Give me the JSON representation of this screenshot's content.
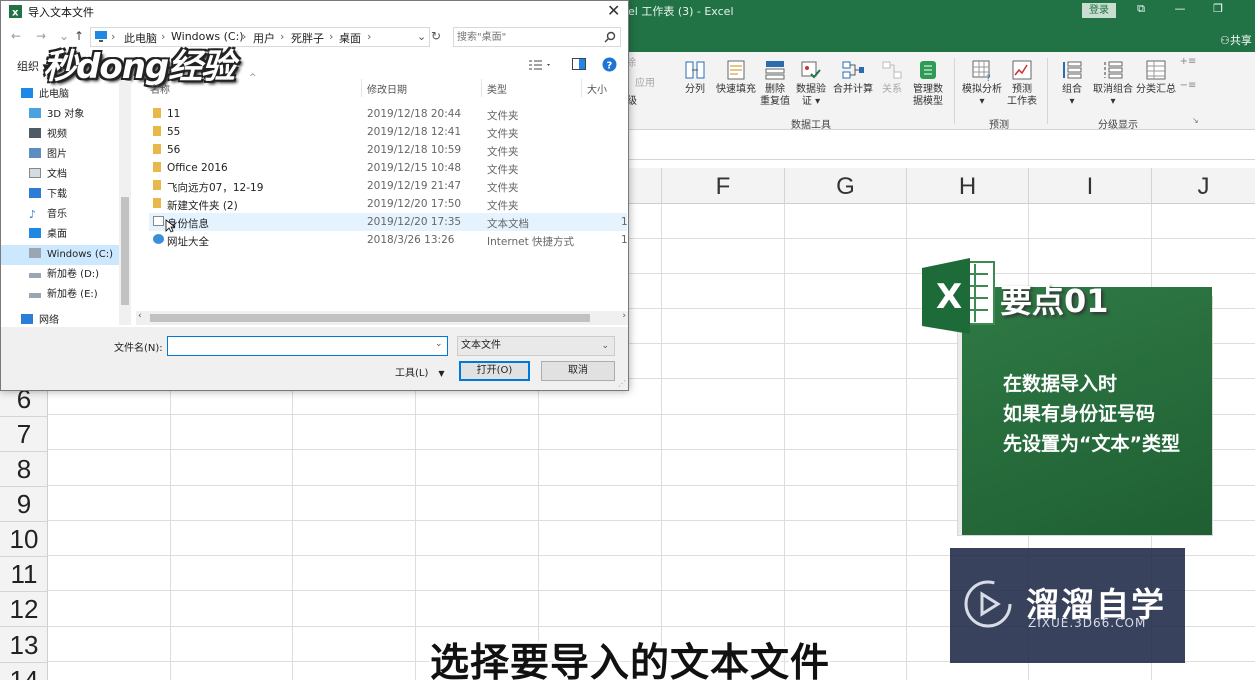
{
  "excel": {
    "title": "el 工作表 (3)  -  Excel",
    "login": "登录",
    "share": "共享",
    "window_controls": {
      "min": "—",
      "restore": "❐",
      "close": "✕",
      "ribbon_display": "⧉"
    },
    "ribbon": {
      "partial_labels": [
        "除",
        "应用",
        "级"
      ],
      "buttons": [
        {
          "label": "分列",
          "disabled": false
        },
        {
          "label": "快速填充",
          "disabled": false
        },
        {
          "label": "删除\n重复值",
          "disabled": false
        },
        {
          "label": "数据验\n证 ▾",
          "disabled": false
        },
        {
          "label": "合并计算",
          "disabled": false
        },
        {
          "label": "关系",
          "disabled": true
        },
        {
          "label": "管理数\n据模型",
          "disabled": false
        },
        {
          "label": "模拟分析\n▾",
          "disabled": false
        },
        {
          "label": "预测\n工作表",
          "disabled": false
        },
        {
          "label": "组合\n▾",
          "disabled": false
        },
        {
          "label": "取消组合\n▾",
          "disabled": false
        },
        {
          "label": "分类汇总",
          "disabled": false
        }
      ],
      "groups": [
        "数据工具",
        "预测",
        "分级显示"
      ]
    },
    "columns": [
      "F",
      "G",
      "H",
      "I",
      "J"
    ],
    "rows": [
      "6",
      "7",
      "8",
      "9",
      "10",
      "11",
      "12",
      "13",
      "14"
    ]
  },
  "overlay": {
    "heading": "要点01",
    "lines": [
      "在数据导入时",
      "如果有身份证号码",
      "先设置为“文本”类型"
    ],
    "logo_letter": "X",
    "watermark_name": "溜溜自学",
    "watermark_url": "ZIXUE.3D66.COM",
    "subtitle": "选择要导入的文本文件",
    "corner_logo": "秒dong经验"
  },
  "dialog": {
    "title": "导入文本文件",
    "close": "✕",
    "nav": {
      "back": "←",
      "forward": "→",
      "recent": "⌄",
      "up": "↑",
      "refresh": "↻"
    },
    "breadcrumbs": [
      "此电脑",
      "Windows (C:)",
      "用户",
      "死胖子",
      "桌面"
    ],
    "search_placeholder": "搜索\"桌面\"",
    "organize": "组织 ▾",
    "nav_items": [
      {
        "label": "此电脑",
        "icon": "computer-icon"
      },
      {
        "label": "3D 对象",
        "icon": "cube-icon"
      },
      {
        "label": "视频",
        "icon": "video-icon"
      },
      {
        "label": "图片",
        "icon": "picture-icon"
      },
      {
        "label": "文档",
        "icon": "document-icon"
      },
      {
        "label": "下载",
        "icon": "download-icon"
      },
      {
        "label": "音乐",
        "icon": "music-icon"
      },
      {
        "label": "桌面",
        "icon": "desktop-icon"
      },
      {
        "label": "Windows (C:)",
        "icon": "drive-icon",
        "selected": true
      },
      {
        "label": "新加卷 (D:)",
        "icon": "drive-icon"
      },
      {
        "label": "新加卷 (E:)",
        "icon": "drive-icon"
      },
      {
        "label": "网络",
        "icon": "network-icon"
      }
    ],
    "columns": {
      "name": "名称",
      "date": "修改日期",
      "type": "类型",
      "size": "大小"
    },
    "files": [
      {
        "name": "11",
        "date": "2019/12/18 20:44",
        "type": "文件夹",
        "size": "",
        "icon": "folder-icon"
      },
      {
        "name": "55",
        "date": "2019/12/18 12:41",
        "type": "文件夹",
        "size": "",
        "icon": "folder-icon"
      },
      {
        "name": "56",
        "date": "2019/12/18 10:59",
        "type": "文件夹",
        "size": "",
        "icon": "folder-icon"
      },
      {
        "name": "Office 2016",
        "date": "2019/12/15 10:48",
        "type": "文件夹",
        "size": "",
        "icon": "folder-icon"
      },
      {
        "name": "飞向远方07，12-19",
        "date": "2019/12/19 21:47",
        "type": "文件夹",
        "size": "",
        "icon": "folder-icon"
      },
      {
        "name": "新建文件夹 (2)",
        "date": "2019/12/20 17:50",
        "type": "文件夹",
        "size": "",
        "icon": "folder-icon"
      },
      {
        "name": "身份信息",
        "date": "2019/12/20 17:35",
        "type": "文本文档",
        "size": "1",
        "icon": "text-file-icon",
        "selected": true
      },
      {
        "name": "网址大全",
        "date": "2018/3/26 13:26",
        "type": "Internet 快捷方式",
        "size": "1",
        "icon": "internet-shortcut-icon"
      }
    ],
    "filename_label": "文件名(N):",
    "filename_value": "",
    "filetype": "文本文件",
    "tools": "工具(L)",
    "open": "打开(O)",
    "cancel": "取消"
  }
}
